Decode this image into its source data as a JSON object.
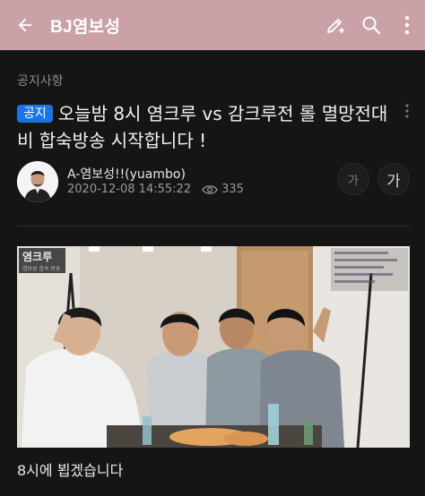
{
  "appbar": {
    "title": "BJ염보성",
    "background": "#c9a1a7",
    "icons": [
      "back-arrow-icon",
      "write-icon",
      "search-icon",
      "more-vertical-icon"
    ]
  },
  "post": {
    "board": "공지사항",
    "badge": "공지",
    "badge_color": "#1a73e8",
    "title": "오늘밤 8시 염크루 vs 감크루전 롤 멸망전대비 합숙방송 시작합니다 !",
    "author": "A-염보성!!(yuambo)",
    "date": "2020-12-08 14:55:22",
    "views": "335",
    "font_small_label": "가",
    "font_large_label": "가",
    "image": {
      "overlay_title": "염크루",
      "overlay_subtitle": "염보성 합숙 방송"
    },
    "caption": "8시에 뵙겠습니다"
  }
}
